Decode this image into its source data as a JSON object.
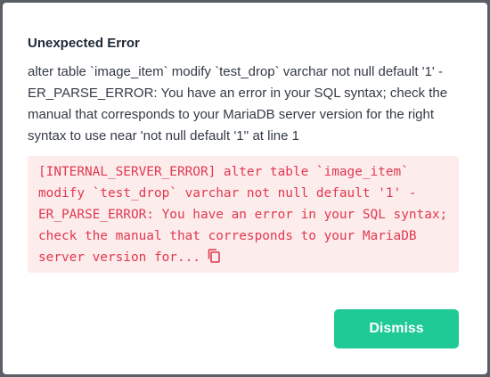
{
  "dialog": {
    "title": "Unexpected Error",
    "message": "alter table `image_item` modify `test_drop` varchar not null default '1' - ER_PARSE_ERROR: You have an error in your SQL syntax; check the manual that corresponds to your MariaDB server version for the right syntax to use near 'not null default '1'' at line 1",
    "details": "[INTERNAL_SERVER_ERROR] alter table `image_item` modify `test_drop` varchar not null default '1' - ER_PARSE_ERROR: You have an error in your SQL syntax; check the manual that corresponds to your MariaDB server version for...",
    "copy_icon": "copy-icon",
    "dismiss_label": "Dismiss"
  },
  "colors": {
    "accent": "#1fca96",
    "error_text": "#e0394f",
    "error_bg": "#fdecec"
  }
}
